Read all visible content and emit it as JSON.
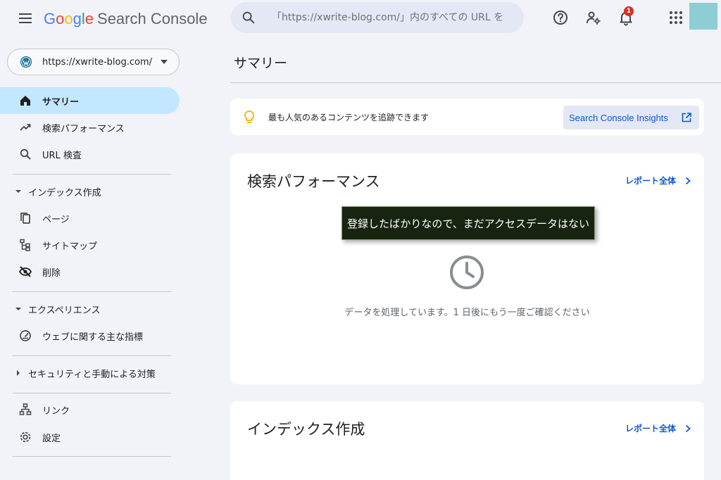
{
  "header": {
    "logo_letters": [
      "G",
      "o",
      "o",
      "g",
      "l",
      "e"
    ],
    "product": "Search Console",
    "search_placeholder": "「https://xwrite-blog.com/」内のすべての URL を検査",
    "notification_count": "1",
    "icons": [
      "menu-icon",
      "search-icon",
      "help-icon",
      "users-settings-icon",
      "bell-icon",
      "apps-icon"
    ],
    "avatar_color": "#8ecdd3"
  },
  "sidebar": {
    "property_url": "https://xwrite-blog.com/",
    "items": [
      {
        "label": "サマリー",
        "icon": "home-icon",
        "active": true
      },
      {
        "label": "検索パフォーマンス",
        "icon": "trending-up-icon"
      },
      {
        "label": "URL 検査",
        "icon": "search-icon"
      }
    ],
    "index_section": {
      "label": "インデックス作成",
      "items": [
        {
          "label": "ページ",
          "icon": "pages-icon"
        },
        {
          "label": "サイトマップ",
          "icon": "sitemap-icon"
        },
        {
          "label": "削除",
          "icon": "eye-off-icon"
        }
      ]
    },
    "experience_section": {
      "label": "エクスペリエンス",
      "items": [
        {
          "label": "ウェブに関する主な指標",
          "icon": "gauge-icon"
        }
      ]
    },
    "security_section": {
      "label": "セキュリティと手動による対策"
    },
    "bottom_items": [
      {
        "label": "リンク",
        "icon": "links-icon"
      },
      {
        "label": "設定",
        "icon": "gear-icon"
      }
    ]
  },
  "main": {
    "title": "サマリー",
    "tip": {
      "text": "最も人気のあるコンテンツを追跡できます",
      "button_label": "Search Console Insights"
    },
    "performance": {
      "title": "検索パフォーマンス",
      "report_link": "レポート全体",
      "callout": "登録したばかりなので、まだアクセスデータはない",
      "processing_text": "データを処理しています。1 日後にもう一度ご確認ください"
    },
    "index": {
      "title": "インデックス作成",
      "report_link": "レポート全体"
    }
  },
  "colors": {
    "background": "#f1f3f8",
    "active_nav": "#c2e7ff",
    "link_blue": "#0b57d0",
    "callout_bg": "#17240f"
  }
}
